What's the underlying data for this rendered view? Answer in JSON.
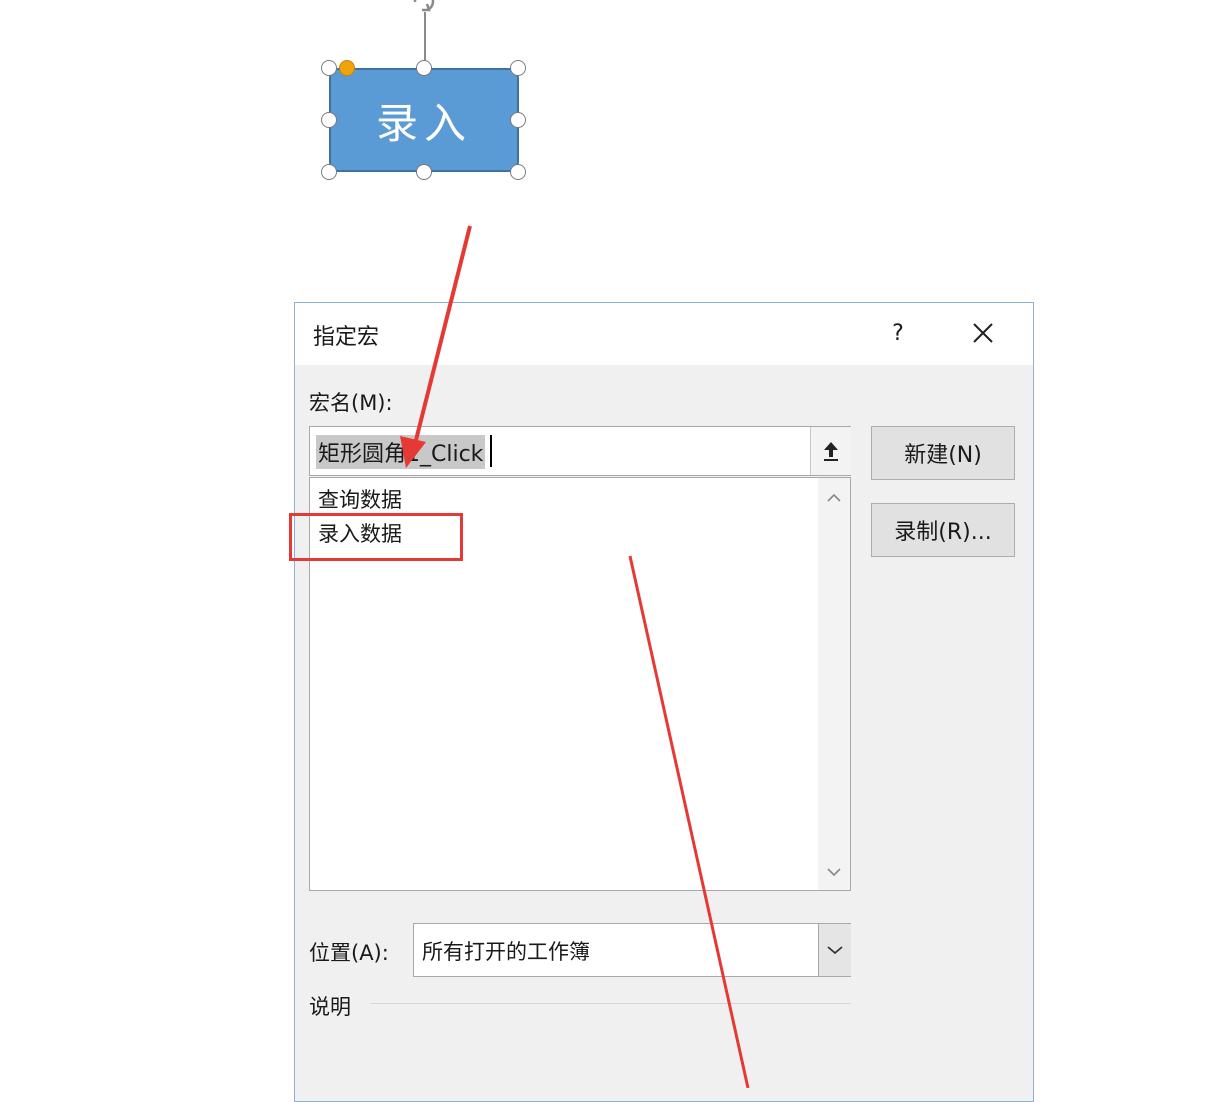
{
  "canvas": {
    "shape_text": "录入"
  },
  "dialog": {
    "title": "指定宏",
    "help_label": "?",
    "close_icon": "close-icon",
    "macro_name_label": "宏名(M):",
    "macro_name_value": "矩形圆角1_Click",
    "collapse_icon": "upload-arrow-icon",
    "macros": [
      "查询数据",
      "录入数据"
    ],
    "new_button": "新建(N)",
    "record_button": "录制(R)...",
    "location_label": "位置(A):",
    "location_value": "所有打开的工作簿",
    "description_label": "说明"
  },
  "annotation": {
    "color": "#e53935"
  }
}
